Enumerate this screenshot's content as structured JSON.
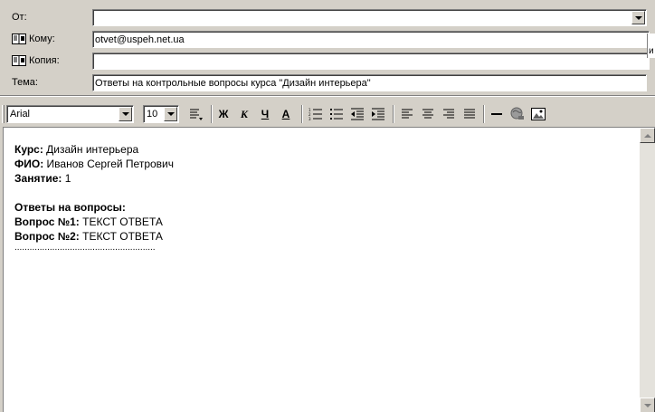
{
  "header": {
    "from_label": "От:",
    "from_value": "",
    "to_label": "Кому:",
    "to_value": "otvet@uspeh.net.ua",
    "cc_label": "Копия:",
    "cc_value": "",
    "subject_label": "Тема:",
    "subject_value": "Ответы на контрольные вопросы курса \"Дизайн интерьера\"",
    "overflow_char": "и"
  },
  "toolbar": {
    "font_name": "Arial",
    "font_size": "10",
    "bold_label": "Ж",
    "italic_label": "К",
    "underline_label": "Ч",
    "color_label": "А"
  },
  "body": {
    "course_label": "Курс:",
    "course_value": " Дизайн интерьера",
    "name_label": "ФИО:",
    "name_value": " Иванов Сергей Петрович",
    "lesson_label": "Занятие:",
    "lesson_value": " 1",
    "answers_heading": "Ответы на вопросы:",
    "q1_label": "Вопрос №1:",
    "q1_value": " ТЕКСТ ОТВЕТА",
    "q2_label": "Вопрос №2:",
    "q2_value": " ТЕКСТ ОТВЕТА",
    "dots": "........................................................"
  },
  "icons": [
    "book-icon",
    "paragraph-style-icon",
    "numbered-list-icon",
    "bullet-list-icon",
    "decrease-indent-icon",
    "increase-indent-icon",
    "align-left-icon",
    "align-center-icon",
    "align-right-icon",
    "justify-icon",
    "horizontal-line-icon",
    "hyperlink-icon",
    "insert-picture-icon"
  ]
}
